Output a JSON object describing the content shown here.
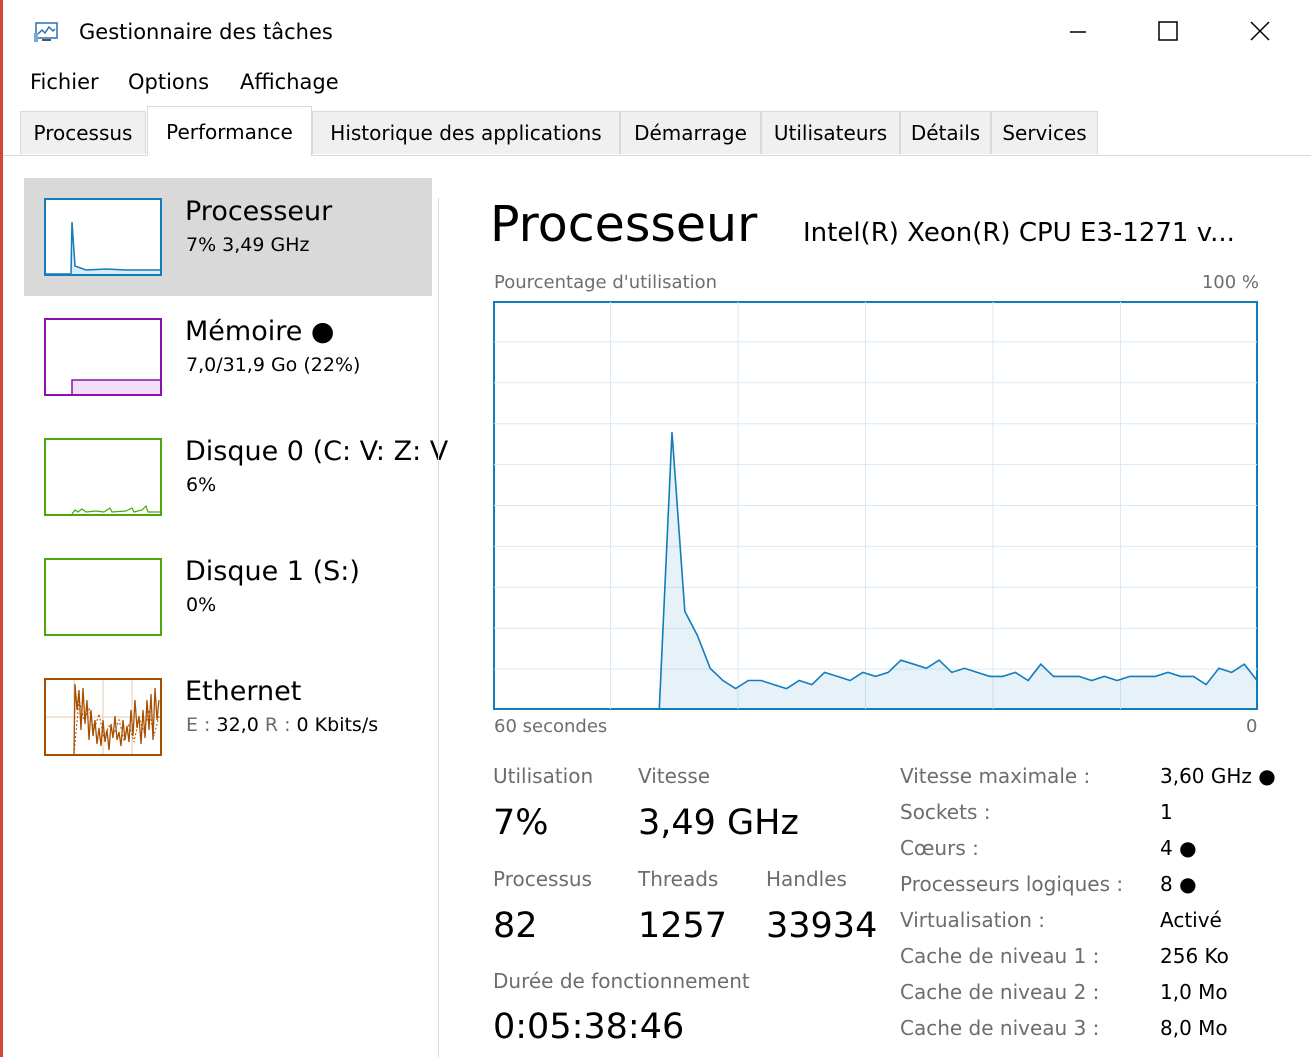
{
  "window": {
    "title": "Gestionnaire des tâches",
    "icon": "task-manager-icon",
    "controls": [
      "minimize-icon",
      "maximize-icon",
      "close-icon"
    ]
  },
  "menu": [
    "Fichier",
    "Options",
    "Affichage"
  ],
  "tabs": [
    "Processus",
    "Performance",
    "Historique des applications",
    "Démarrage",
    "Utilisateurs",
    "Détails",
    "Services"
  ],
  "active_tab": "Performance",
  "sidebar": {
    "items": [
      {
        "title": "Processeur",
        "subtitle": "7% 3,49 GHz",
        "color": "#117dbb",
        "selected": true
      },
      {
        "title": "Mémoire ●",
        "subtitle": "7,0/31,9 Go (22%)",
        "color": "#8b12ae",
        "selected": false
      },
      {
        "title": "Disque 0 (C: V: Z: V",
        "subtitle": "6%",
        "color": "#4da60c",
        "selected": false
      },
      {
        "title": "Disque 1 (S:)",
        "subtitle": "0%",
        "color": "#4da60c",
        "selected": false
      },
      {
        "title": "Ethernet",
        "subtitle_parts": [
          "E : ",
          "32,0",
          " R : ",
          "0 Kbits/s"
        ],
        "color": "#a74f01",
        "selected": false
      }
    ]
  },
  "main": {
    "title": "Processeur",
    "model": "Intel(R) Xeon(R) CPU E3-1271 v...",
    "graph_label": "Pourcentage d'utilisation",
    "graph_max": "100 %",
    "axis_left": "60 secondes",
    "axis_right": "0",
    "accent": "#117dbb",
    "stats": {
      "utilisation_label": "Utilisation",
      "utilisation": "7%",
      "vitesse_label": "Vitesse",
      "vitesse": "3,49 GHz",
      "processus_label": "Processus",
      "processus": "82",
      "threads_label": "Threads",
      "threads": "1257",
      "handles_label": "Handles",
      "handles": "33934",
      "uptime_label": "Durée de fonctionnement",
      "uptime": "0:05:38:46"
    },
    "info": [
      {
        "label": "Vitesse maximale :",
        "value": "3,60 GHz ●"
      },
      {
        "label": "Sockets :",
        "value": "1"
      },
      {
        "label": "Cœurs :",
        "value": "4 ●"
      },
      {
        "label": "Processeurs logiques :",
        "value": "8 ●"
      },
      {
        "label": "Virtualisation :",
        "value": "Activé"
      },
      {
        "label": "Cache de niveau 1 :",
        "value": "256 Ko"
      },
      {
        "label": "Cache de niveau 2 :",
        "value": "1,0 Mo"
      },
      {
        "label": "Cache de niveau 3 :",
        "value": "8,0 Mo"
      }
    ]
  },
  "chart_data": {
    "type": "area",
    "ylim": [
      0,
      100
    ],
    "xlabel": "60 secondes",
    "ylabel": "Pourcentage d'utilisation",
    "x_range": [
      60,
      0
    ],
    "series": [
      {
        "x": [
          47,
          46,
          45,
          44,
          43,
          42,
          41,
          40,
          39,
          38,
          37,
          36,
          35,
          34,
          33,
          32,
          31,
          30,
          29,
          28,
          27,
          26,
          25,
          24,
          23,
          22,
          21,
          20,
          19,
          18,
          17,
          16,
          15,
          14,
          13,
          12,
          11,
          10,
          9,
          8,
          7,
          6,
          5,
          4,
          3,
          2,
          1,
          0
        ],
        "values": [
          0,
          68,
          24,
          18,
          10,
          7,
          5,
          7,
          7,
          6,
          5,
          7,
          6,
          9,
          8,
          7,
          9,
          8,
          9,
          12,
          11,
          10,
          12,
          9,
          10,
          9,
          8,
          8,
          9,
          7,
          11,
          8,
          8,
          8,
          7,
          8,
          7,
          8,
          8,
          8,
          9,
          8,
          8,
          6,
          10,
          9,
          11,
          7
        ]
      }
    ]
  }
}
